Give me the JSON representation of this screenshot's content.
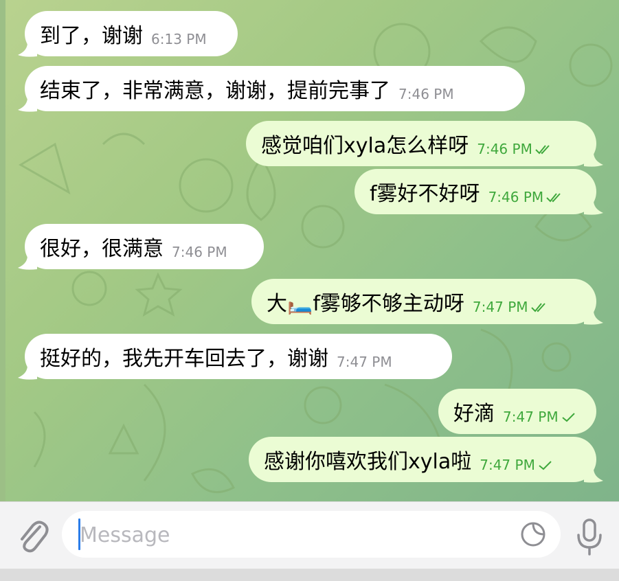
{
  "composer": {
    "placeholder": "Message"
  },
  "messages": [
    {
      "direction": "incoming",
      "text": "到了，谢谢",
      "time": "6:13 PM"
    },
    {
      "direction": "incoming",
      "text": "结束了，非常满意，谢谢，提前完事了",
      "time": "7:46 PM"
    },
    {
      "direction": "outgoing",
      "text": "感觉咱们xyla怎么样呀",
      "time": "7:46 PM",
      "status": "read"
    },
    {
      "direction": "outgoing",
      "text": "f雾好不好呀",
      "time": "7:46 PM",
      "status": "read"
    },
    {
      "direction": "incoming",
      "text": "很好，很满意",
      "time": "7:46 PM"
    },
    {
      "direction": "outgoing",
      "text": "大🛏️f雾够不够主动呀",
      "time": "7:47 PM",
      "status": "read"
    },
    {
      "direction": "incoming",
      "text": "挺好的，我先开车回去了，谢谢",
      "time": "7:47 PM"
    },
    {
      "direction": "outgoing",
      "text": "好滴",
      "time": "7:47 PM",
      "status": "sent"
    },
    {
      "direction": "outgoing",
      "text": "感谢你嘻欢我们xyla啦",
      "time": "7:47 PM",
      "status": "sent"
    }
  ],
  "colors": {
    "incoming_bubble": "#ffffff",
    "outgoing_bubble": "#ebfcd4",
    "outgoing_time": "#3fa83c",
    "incoming_time": "#8e8e93",
    "caret": "#2b7de9"
  }
}
